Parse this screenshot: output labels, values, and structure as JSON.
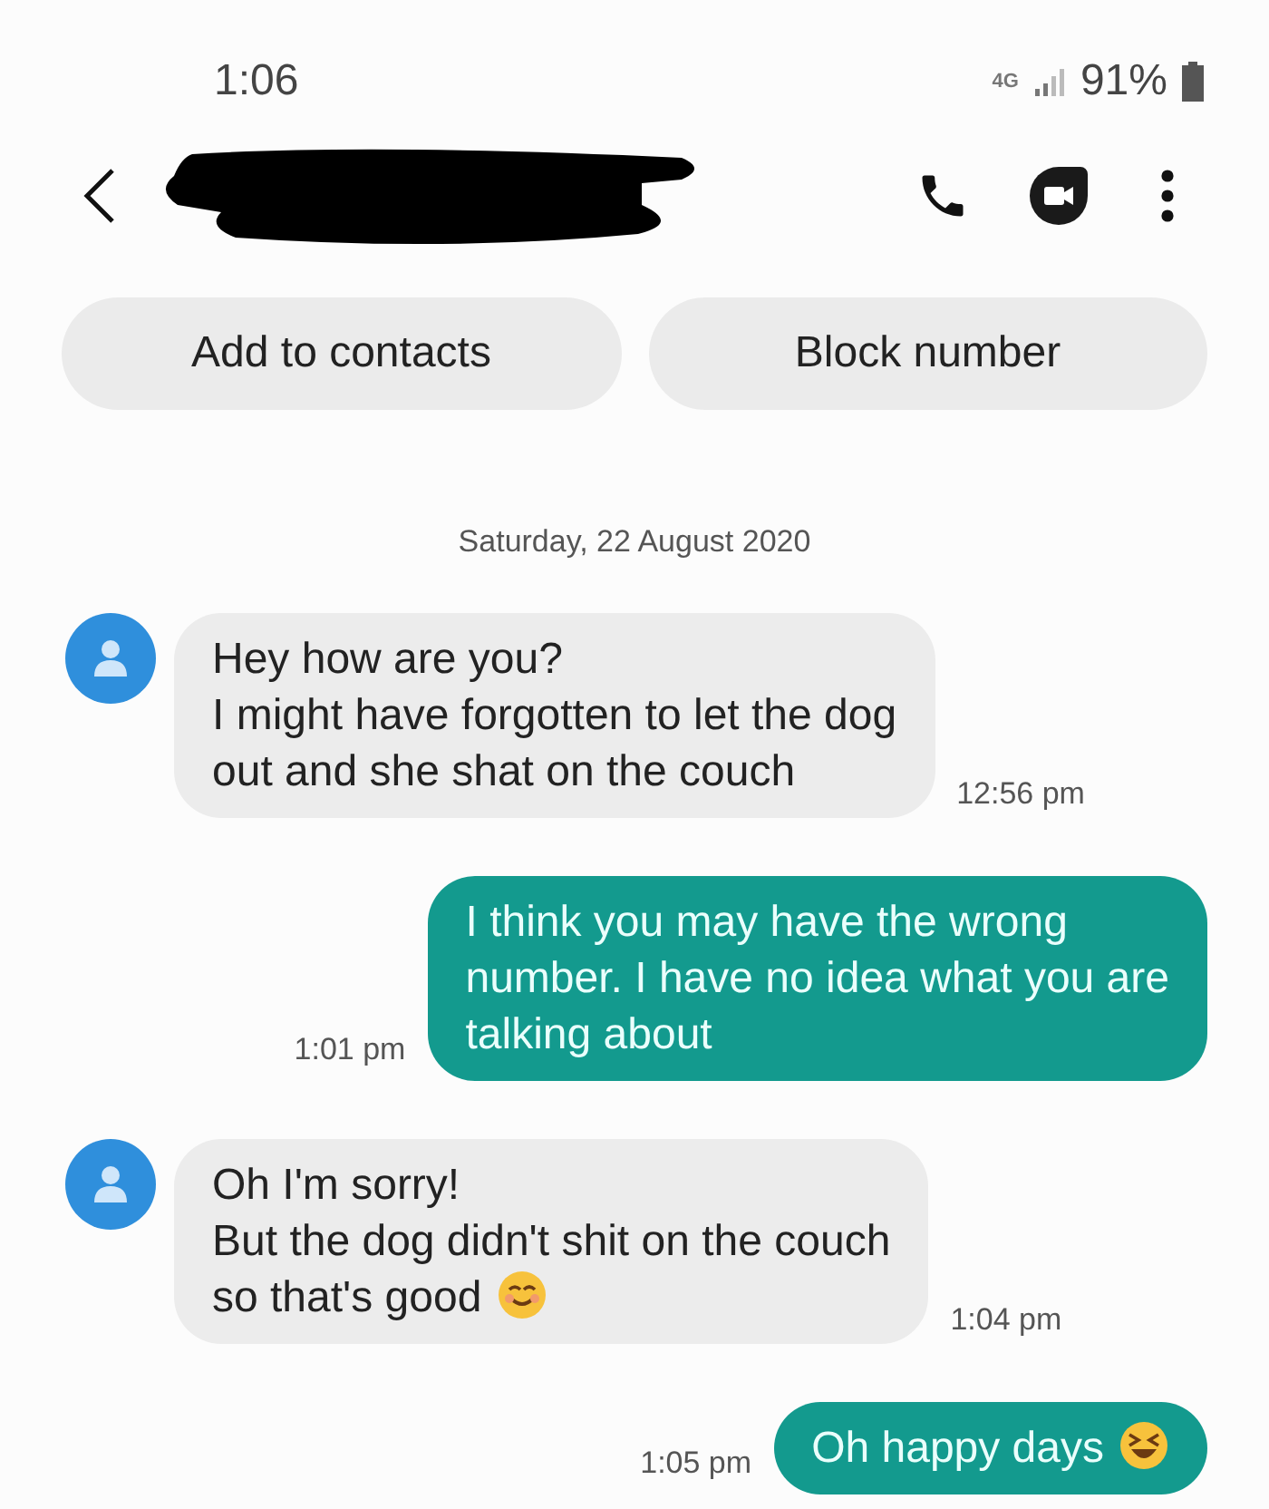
{
  "status_bar": {
    "time": "1:06",
    "network": "4G",
    "battery": "91%"
  },
  "header": {
    "actions": [
      {
        "kind": "call"
      },
      {
        "kind": "video"
      },
      {
        "kind": "more"
      }
    ]
  },
  "quick_actions": [
    "Add to contacts",
    "Block number"
  ],
  "date": "Saturday, 22 August 2020",
  "messages": [
    {
      "kind": "incoming",
      "text": "Hey how are you?\nI might have forgotten to let the dog\nout and she shat on the couch",
      "time": "12:56 pm"
    },
    {
      "kind": "outgoing",
      "text": "I think you may have the wrong\nnumber. I have no idea what you are\ntalking about",
      "time": "1:01 pm"
    },
    {
      "kind": "incoming",
      "text": "Oh I'm sorry!\nBut the dog didn't shit on the couch\nso that's good",
      "trailing_icon": {
        "kind": "smile"
      },
      "time": "1:04 pm"
    },
    {
      "kind": "outgoing",
      "text": "Oh happy days",
      "trailing_icon": {
        "kind": "laugh"
      },
      "time": "1:05 pm"
    }
  ]
}
